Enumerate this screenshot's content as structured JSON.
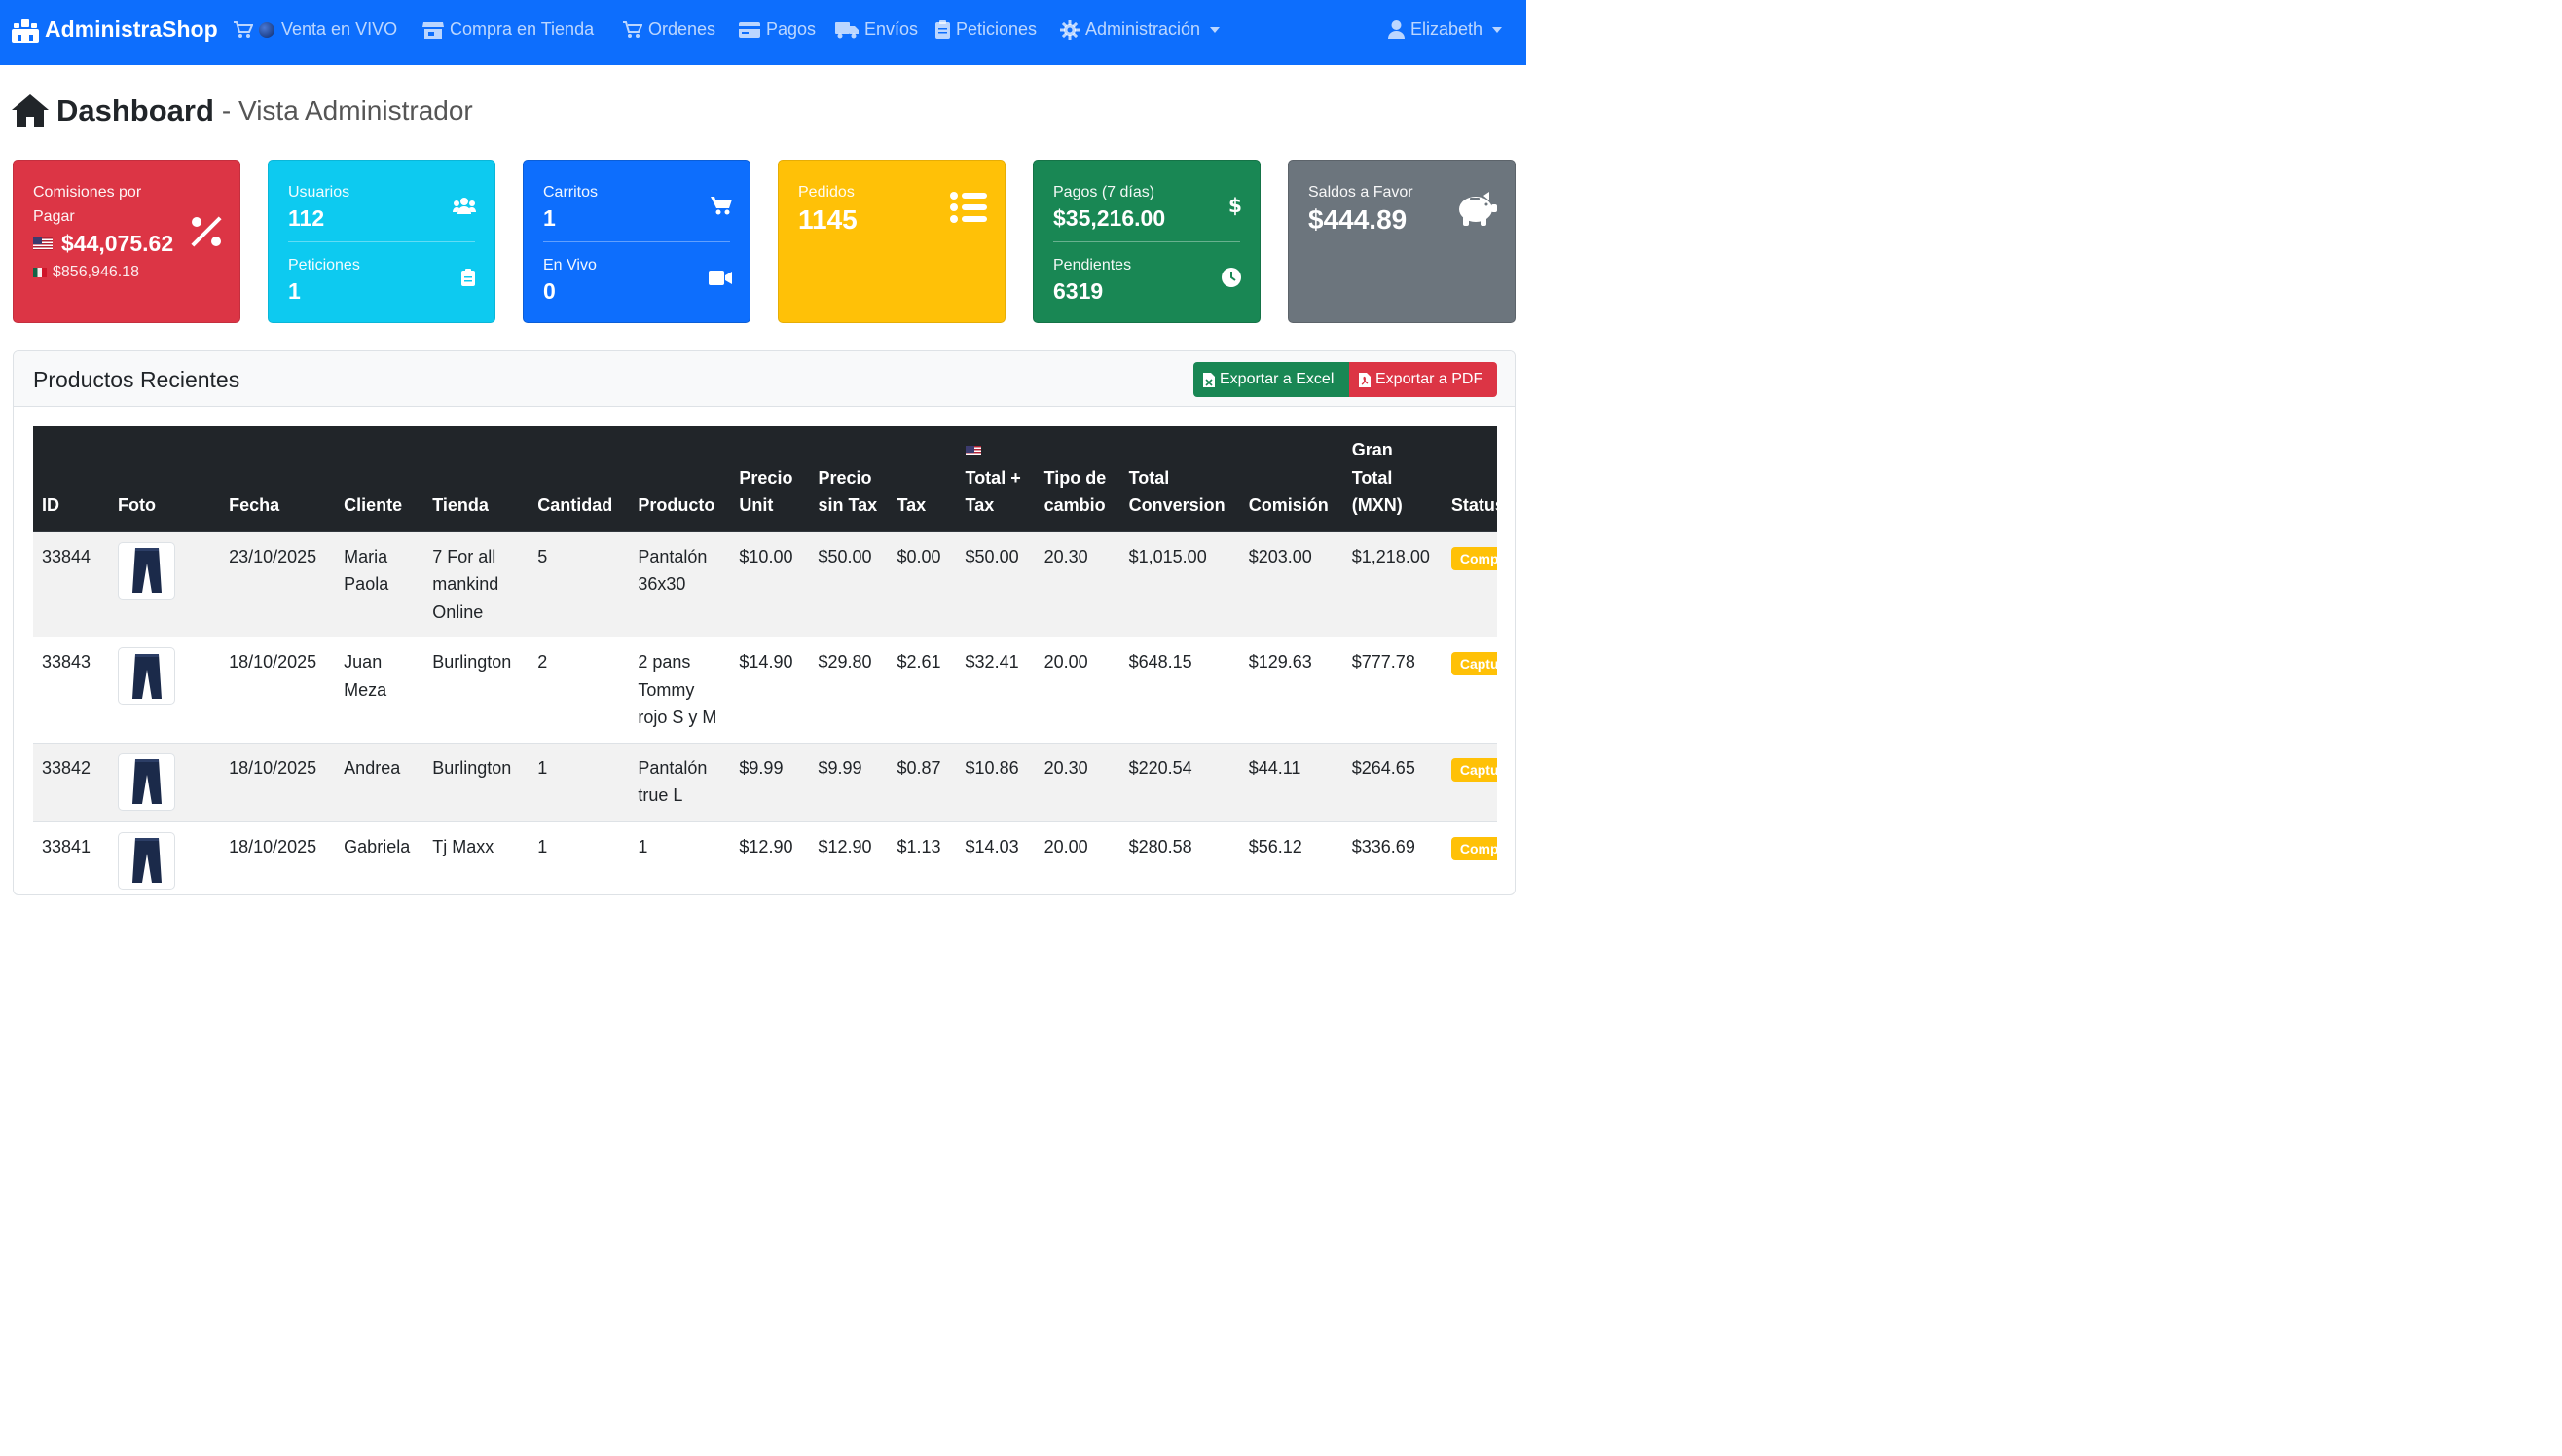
{
  "navbar": {
    "brand": "AdministraShop",
    "items": [
      {
        "label": "Venta en VIVO",
        "icon": "cart-icon"
      },
      {
        "label": "Compra en Tienda",
        "icon": "store-icon"
      },
      {
        "label": "Ordenes",
        "icon": "cart-icon"
      },
      {
        "label": "Pagos",
        "icon": "credit-card-icon"
      },
      {
        "label": "Envíos",
        "icon": "truck-icon"
      },
      {
        "label": "Peticiones",
        "icon": "clipboard-icon"
      },
      {
        "label": "Administración",
        "icon": "gear-icon"
      }
    ],
    "user": "Elizabeth",
    "color": "#0d6efd"
  },
  "page": {
    "title": "Dashboard",
    "subtitle": "- Vista Administrador"
  },
  "cards": {
    "comisiones": {
      "label": "Comisiones por Pagar",
      "usd": "$44,075.62",
      "mxn": "$856,946.18",
      "color": "#dc3545"
    },
    "usuarios": {
      "label": "Usuarios",
      "value": "112",
      "sub_label": "Peticiones",
      "sub_value": "1",
      "color": "#0dcaf0"
    },
    "carritos": {
      "label": "Carritos",
      "value": "1",
      "sub_label": "En Vivo",
      "sub_value": "0",
      "color": "#0d6efd"
    },
    "pedidos": {
      "label": "Pedidos",
      "value": "1145",
      "color": "#ffc107"
    },
    "pagos": {
      "label": "Pagos (7 días)",
      "value": "$35,216.00",
      "sub_label": "Pendientes",
      "sub_value": "6319",
      "color": "#198754"
    },
    "saldos": {
      "label": "Saldos a Favor",
      "value": "$444.89",
      "color": "#6c757d"
    }
  },
  "panel": {
    "title": "Productos Recientes",
    "export_excel": "Exportar a Excel",
    "export_pdf": "Exportar a PDF"
  },
  "table": {
    "headers": [
      "ID",
      "Foto",
      "Fecha",
      "Cliente",
      "Tienda",
      "Cantidad",
      "Producto",
      "Precio Unit",
      "Precio sin Tax",
      "Tax",
      "Total + Tax",
      "Tipo de cambio",
      "Total Conversion",
      "Comisión",
      "Gran Total (MXN)",
      "Status"
    ],
    "rows": [
      {
        "id": "33844",
        "fecha": "23/10/2025",
        "cliente": "Maria Paola",
        "tienda": "7 For all mankind Online",
        "cantidad": "5",
        "producto": "Pantalón 36x30",
        "precio_unit": "$10.00",
        "precio_sin_tax": "$50.00",
        "tax": "$0.00",
        "total_tax": "$50.00",
        "tipo_cambio": "20.30",
        "total_conversion": "$1,015.00",
        "comision": "$203.00",
        "gran_total": "$1,218.00",
        "status": "Comp"
      },
      {
        "id": "33843",
        "fecha": "18/10/2025",
        "cliente": "Juan Meza",
        "tienda": "Burlington",
        "cantidad": "2",
        "producto": "2 pans Tommy rojo S y M",
        "precio_unit": "$14.90",
        "precio_sin_tax": "$29.80",
        "tax": "$2.61",
        "total_tax": "$32.41",
        "tipo_cambio": "20.00",
        "total_conversion": "$648.15",
        "comision": "$129.63",
        "gran_total": "$777.78",
        "status": "Captu"
      },
      {
        "id": "33842",
        "fecha": "18/10/2025",
        "cliente": "Andrea",
        "tienda": "Burlington",
        "cantidad": "1",
        "producto": "Pantalón true L",
        "precio_unit": "$9.99",
        "precio_sin_tax": "$9.99",
        "tax": "$0.87",
        "total_tax": "$10.86",
        "tipo_cambio": "20.30",
        "total_conversion": "$220.54",
        "comision": "$44.11",
        "gran_total": "$264.65",
        "status": "Captu"
      },
      {
        "id": "33841",
        "fecha": "18/10/2025",
        "cliente": "Gabriela",
        "tienda": "Tj Maxx",
        "cantidad": "1",
        "producto": "1",
        "precio_unit": "$12.90",
        "precio_sin_tax": "$12.90",
        "tax": "$1.13",
        "total_tax": "$14.03",
        "tipo_cambio": "20.00",
        "total_conversion": "$280.58",
        "comision": "$56.12",
        "gran_total": "$336.69",
        "status": "Comp"
      }
    ]
  }
}
